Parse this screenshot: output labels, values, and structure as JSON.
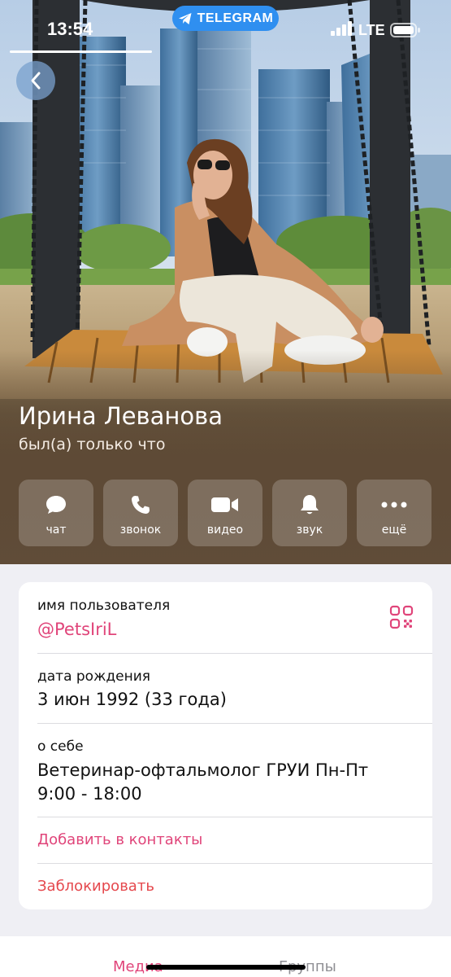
{
  "status_bar": {
    "time": "13:54",
    "app_pill": "TELEGRAM",
    "network": "LTE"
  },
  "profile": {
    "name": "Ирина Леванова",
    "status": "был(а) только что"
  },
  "actions": [
    {
      "label": "чат",
      "icon": "chat-bubble-icon"
    },
    {
      "label": "звонок",
      "icon": "phone-icon"
    },
    {
      "label": "видео",
      "icon": "video-camera-icon"
    },
    {
      "label": "звук",
      "icon": "bell-icon"
    },
    {
      "label": "ещё",
      "icon": "more-dots-icon"
    }
  ],
  "info": {
    "username_label": "имя пользователя",
    "username_value": "@PetsIriL",
    "birthday_label": "дата рождения",
    "birthday_value": "3 июн 1992 (33 года)",
    "about_label": "о себе",
    "about_line1": "Ветеринар-офтальмолог ГРУИ Пн-Пт",
    "about_line2": "9:00 - 18:00",
    "add_contact": "Добавить в контакты",
    "block": "Заблокировать"
  },
  "tabs": {
    "media": "Медиа",
    "groups": "Группы"
  },
  "colors": {
    "accent": "#e0457a",
    "danger": "#e5484d",
    "telegram_blue": "#2f8ff0",
    "background": "#efeff4"
  }
}
